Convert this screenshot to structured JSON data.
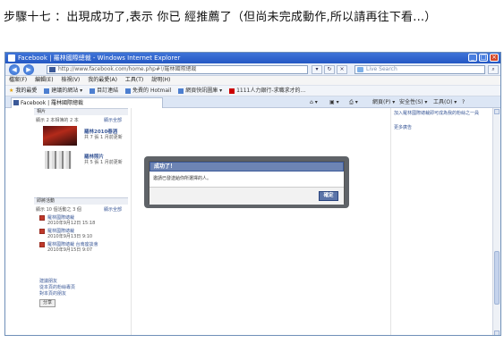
{
  "caption": "步驟十七 ：出現成功了,表示 你已 經推薦了（但尚未完成動作,所以請再往下看...）",
  "window": {
    "title": "Facebook | 羅林國際總裁 - Windows Internet Explorer",
    "controls": {
      "minimize": "_",
      "maximize": "□",
      "close": "×"
    }
  },
  "addressbar": {
    "back": "◀",
    "forward": "▶",
    "url": "http://www.facebook.com/home.php#!/羅林國際總裁",
    "search_placeholder": "Live Search"
  },
  "menubar": [
    "檔案(F)",
    "編輯(E)",
    "檢視(V)",
    "我的最愛(A)",
    "工具(T)",
    "說明(H)"
  ],
  "favbar": {
    "label": "我的最愛",
    "items": [
      "建議的網站 ▾",
      "目訂連結",
      "免費的 Hotmail",
      "網頁快訊圖庫 ▾",
      "1111人力銀行-求職求才的..."
    ]
  },
  "tabbar": {
    "tab_title": "Facebook | 羅林國際總裁",
    "commands": [
      "網頁(P) ▾",
      "安全性(S) ▾",
      "工具(O) ▾",
      "?"
    ]
  },
  "leftcol": {
    "photos_head": "相片",
    "photos_sub": "顯示 2 本相簿的 2 本",
    "photos_all": "顯示全部",
    "album1_title": "羅林2010春酒",
    "album1_meta": "共 7 張 1 月前更新",
    "album2_title": "羅林照片",
    "album2_meta": "共 5 張 1 月前更新",
    "events_head": "即將活動",
    "events_sub": "顯示 10 個活動之 3 個",
    "events_all": "顯示全部",
    "events": [
      {
        "title": "羅林國際總裁",
        "date": "2010年9月12日 15:18"
      },
      {
        "title": "羅林國際總裁",
        "date": "2010年9月13日 9:10"
      },
      {
        "title": "羅林國際總裁 台南座談會",
        "date": "2010年9月15日 9:07"
      }
    ],
    "bottom_links": [
      "建議朋友",
      "從本頁的粉絲專頁",
      "對本頁的朋友"
    ],
    "share_button": "分享"
  },
  "rightcol": {
    "notice": "加入羅林國際總裁即可成為我的粉絲之一員",
    "more": "更多廣告"
  },
  "dialog": {
    "title": "成功了！",
    "body": "邀請已發送給你所選擇的人。",
    "ok": "確定"
  }
}
